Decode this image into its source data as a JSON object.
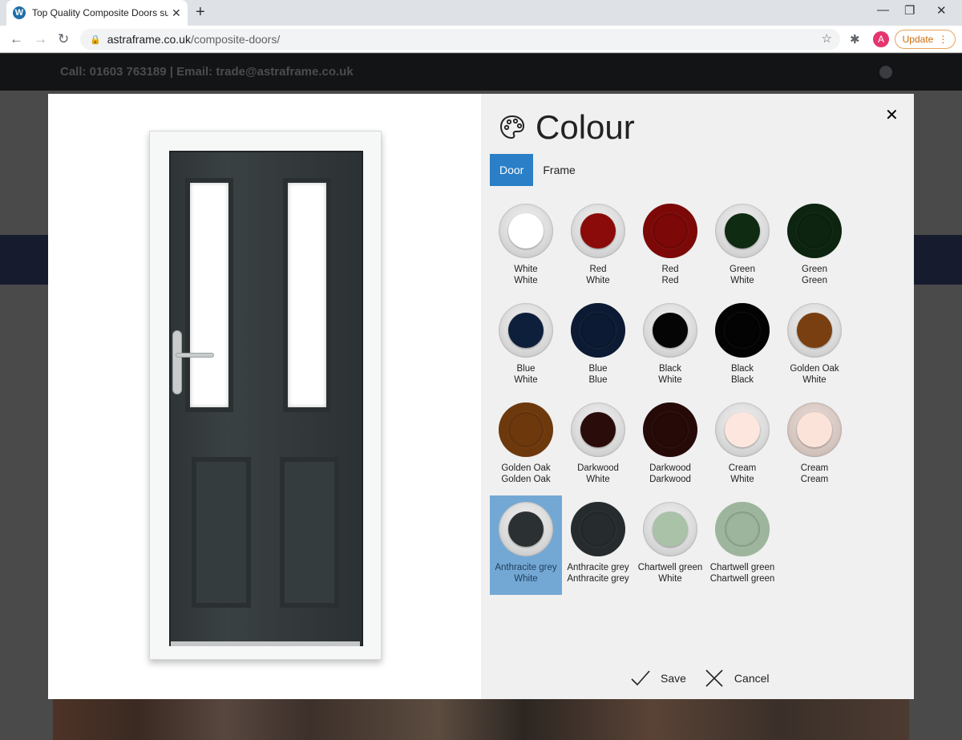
{
  "browser": {
    "tab_title": "Top Quality Composite Doors su",
    "tab_favicon": "wordpress-icon",
    "new_tab": "+",
    "url_domain": "astraframe.co.uk",
    "url_path": "/composite-doors/",
    "profile_initial": "A",
    "update_label": "Update"
  },
  "site": {
    "contact": "Call: 01603 763189 | Email: trade@astraframe.co.uk"
  },
  "colour_dialog": {
    "title": "Colour",
    "tabs": [
      {
        "label": "Door",
        "active": true
      },
      {
        "label": "Frame",
        "active": false
      }
    ],
    "swatches": [
      {
        "line1": "White",
        "line2": "White",
        "color": "#ffffff",
        "style": "ring"
      },
      {
        "line1": "Red",
        "line2": "White",
        "color": "#8b0a0a",
        "style": "ring"
      },
      {
        "line1": "Red",
        "line2": "Red",
        "color": "#7d0808",
        "style": "solid"
      },
      {
        "line1": "Green",
        "line2": "White",
        "color": "#0f2b12",
        "style": "ring"
      },
      {
        "line1": "Green",
        "line2": "Green",
        "color": "#0c2410",
        "style": "solid"
      },
      {
        "line1": "Blue",
        "line2": "White",
        "color": "#0e1f3c",
        "style": "ring"
      },
      {
        "line1": "Blue",
        "line2": "Blue",
        "color": "#0c1a33",
        "style": "solid"
      },
      {
        "line1": "Black",
        "line2": "White",
        "color": "#050505",
        "style": "ring"
      },
      {
        "line1": "Black",
        "line2": "Black",
        "color": "#030303",
        "style": "solid"
      },
      {
        "line1": "Golden Oak",
        "line2": "White",
        "color": "#7a3f10",
        "style": "ring"
      },
      {
        "line1": "Golden Oak",
        "line2": "Golden Oak",
        "color": "#6e380d",
        "style": "solid"
      },
      {
        "line1": "Darkwood",
        "line2": "White",
        "color": "#2a0c0a",
        "style": "ring"
      },
      {
        "line1": "Darkwood",
        "line2": "Darkwood",
        "color": "#260a08",
        "style": "solid"
      },
      {
        "line1": "Cream",
        "line2": "White",
        "color": "#fde6de",
        "style": "ring"
      },
      {
        "line1": "Cream",
        "line2": "Cream",
        "color": "#fbe3da",
        "style": "ring-cream"
      },
      {
        "line1": "Anthracite grey",
        "line2": "White",
        "color": "#2b3133",
        "style": "ring",
        "selected": true
      },
      {
        "line1": "Anthracite grey",
        "line2": "Anthracite grey",
        "color": "#262c2e",
        "style": "solid"
      },
      {
        "line1": "Chartwell green",
        "line2": "White",
        "color": "#a9c2a8",
        "style": "ring"
      },
      {
        "line1": "Chartwell green",
        "line2": "Chartwell green",
        "color": "#9db59c",
        "style": "solid-light"
      }
    ],
    "save_label": "Save",
    "cancel_label": "Cancel"
  },
  "colors": {
    "tab_active": "#2a7fc7",
    "selected_swatch_bg": "#74a8d4"
  }
}
